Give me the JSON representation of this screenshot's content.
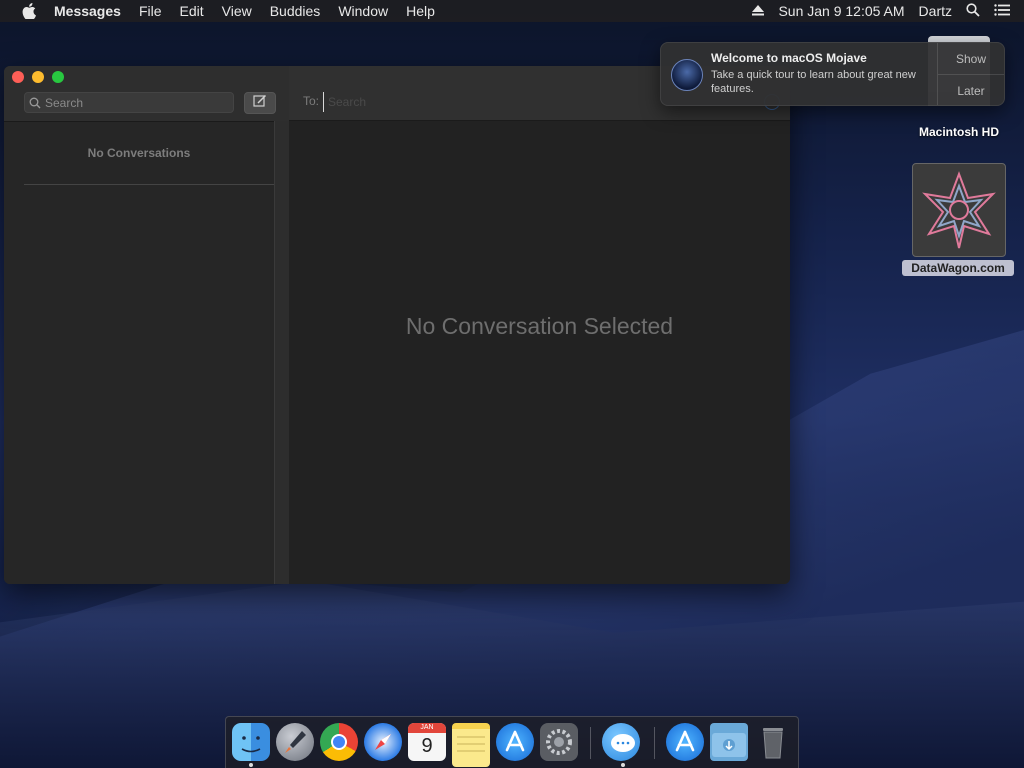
{
  "menubar": {
    "app_name": "Messages",
    "items": [
      "File",
      "Edit",
      "View",
      "Buddies",
      "Window",
      "Help"
    ],
    "datetime": "Sun Jan 9  12:05 AM",
    "user": "Dartz",
    "icons": [
      "apple-icon",
      "eject-icon",
      "spotlight-search-icon",
      "notification-center-icon"
    ]
  },
  "messages": {
    "search_placeholder": "Search",
    "sidebar_empty": "No Conversations",
    "to_label": "To:",
    "to_placeholder": "Search",
    "empty_title": "No Conversation Selected"
  },
  "notification": {
    "title": "Welcome to macOS Mojave",
    "body": "Take a quick tour to learn about great new features.",
    "show_label": "Show",
    "later_label": "Later"
  },
  "desktop": {
    "hd_label": "Macintosh HD",
    "dw_label": "DataWagon.com"
  },
  "dock": {
    "apps": [
      "finder",
      "launchpad",
      "chrome",
      "safari",
      "calendar",
      "notes",
      "app-store",
      "system-preferences",
      "messages",
      "app-store-downloads",
      "downloads-folder",
      "trash"
    ],
    "calendar_month": "JAN",
    "calendar_day": "9"
  },
  "colors": {
    "accent": "#3b7bd4",
    "close": "#fe5f57",
    "minimize": "#febc2e",
    "maximize": "#28c840"
  }
}
